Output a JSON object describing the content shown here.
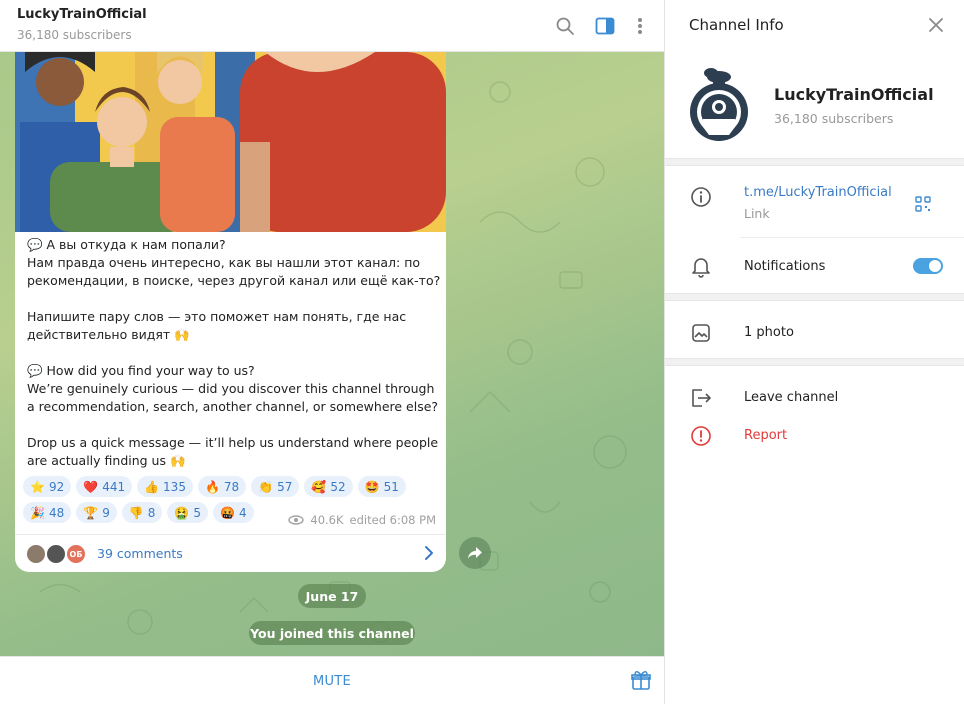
{
  "header": {
    "title": "LuckyTrainOfficial",
    "subtitle": "36,180 subscribers"
  },
  "message": {
    "lines_ru": [
      "💬 А вы откуда к нам попали?",
      "Нам правда очень интересно, как вы нашли этот канал: по рекомендации, в поиске, через другой канал или ещё как-то?",
      "",
      "Напишите пару слов — это поможет нам понять, где нас действительно видят 🙌"
    ],
    "lines_en": [
      "💬 How did you find your way to us?",
      "We’re genuinely curious — did you discover this channel through a recommendation, search, another channel, or somewhere else?",
      "",
      "Drop us a quick message — it’ll help us understand where people are actually finding us 🙌"
    ],
    "reactions_row1": [
      {
        "emoji": "⭐",
        "count": "92"
      },
      {
        "emoji": "❤️",
        "count": "441"
      },
      {
        "emoji": "👍",
        "count": "135"
      },
      {
        "emoji": "🔥",
        "count": "78"
      },
      {
        "emoji": "👏",
        "count": "57"
      },
      {
        "emoji": "🥰",
        "count": "52"
      },
      {
        "emoji": "🤩",
        "count": "51"
      }
    ],
    "reactions_row2": [
      {
        "emoji": "🎉",
        "count": "48"
      },
      {
        "emoji": "🏆",
        "count": "9"
      },
      {
        "emoji": "👎",
        "count": "8"
      },
      {
        "emoji": "🤮",
        "count": "5"
      },
      {
        "emoji": "🤬",
        "count": "4"
      }
    ],
    "views": "40.6K",
    "edited": "edited 6:08 PM",
    "comments": "39 comments",
    "comment_avatar_initials": "ОБ"
  },
  "date_pill": "June 17",
  "joined_pill": "You joined this channel",
  "bottom": {
    "mute_label": "MUTE"
  },
  "panel": {
    "title": "Channel Info",
    "name": "LuckyTrainOfficial",
    "subscribers": "36,180 subscribers",
    "link": "t.me/LuckyTrainOfficial",
    "link_caption": "Link",
    "notifications": "Notifications",
    "notifications_on": true,
    "photos": "1 photo",
    "leave": "Leave channel",
    "report": "Report"
  },
  "colors": {
    "accent": "#3a8bd1",
    "danger": "#e23a3a",
    "chat_bg": "#a9c98a"
  }
}
